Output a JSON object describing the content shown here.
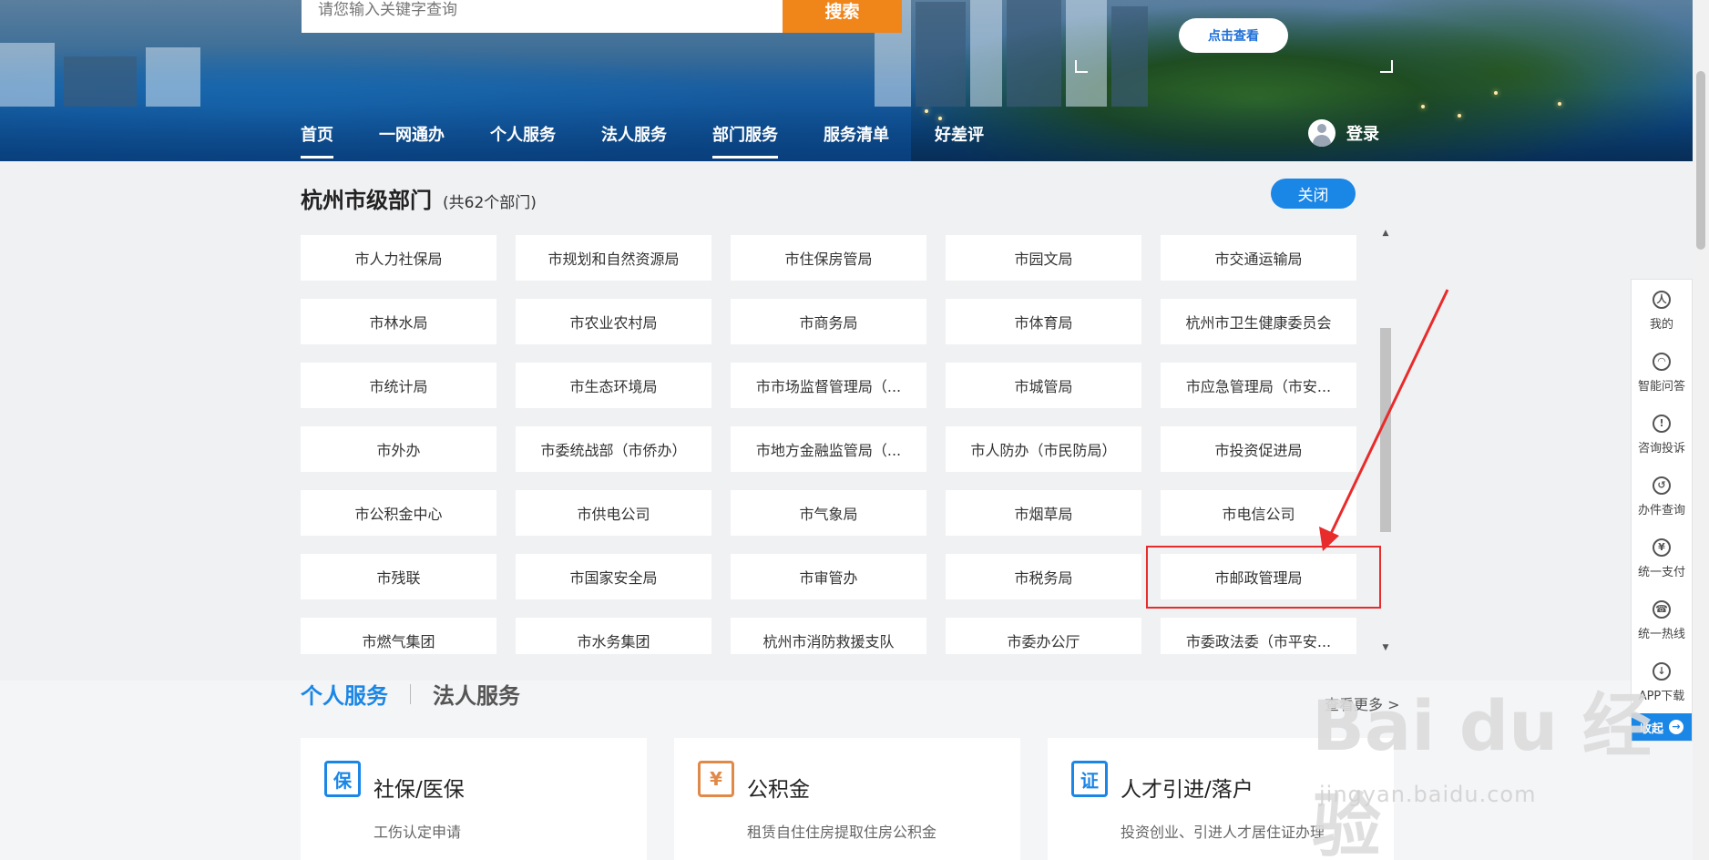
{
  "search": {
    "placeholder": "请您输入关键字查询",
    "button": "搜索"
  },
  "banner": {
    "click_view": "点击查看"
  },
  "nav": {
    "items": [
      "首页",
      "一网通办",
      "个人服务",
      "法人服务",
      "部门服务",
      "服务清单",
      "好差评"
    ],
    "login": "登录"
  },
  "departments": {
    "title": "杭州市级部门",
    "count": "(共62个部门)",
    "close": "关闭",
    "rows": [
      [
        "市人力社保局",
        "市规划和自然资源局",
        "市住保房管局",
        "市园文局",
        "市交通运输局"
      ],
      [
        "市林水局",
        "市农业农村局",
        "市商务局",
        "市体育局",
        "杭州市卫生健康委员会"
      ],
      [
        "市统计局",
        "市生态环境局",
        "市市场监督管理局（...",
        "市城管局",
        "市应急管理局（市安..."
      ],
      [
        "市外办",
        "市委统战部（市侨办）",
        "市地方金融监管局（...",
        "市人防办（市民防局）",
        "市投资促进局"
      ],
      [
        "市公积金中心",
        "市供电公司",
        "市气象局",
        "市烟草局",
        "市电信公司"
      ],
      [
        "市残联",
        "市国家安全局",
        "市审管办",
        "市税务局",
        "市邮政管理局"
      ],
      [
        "市燃气集团",
        "市水务集团",
        "杭州市消防救援支队",
        "市委办公厅",
        "市委政法委（市平安..."
      ]
    ],
    "scroll_up": "▲",
    "scroll_down": "▼"
  },
  "services": {
    "tabs": [
      "个人服务",
      "法人服务"
    ],
    "more": "查看更多 >",
    "cards": [
      {
        "icon": "保",
        "title": "社保/医保",
        "sub": "工伤认定申请",
        "sub2": ""
      },
      {
        "icon": "¥",
        "title": "公积金",
        "sub": "租赁自住住房提取住房公积金",
        "sub2": ""
      },
      {
        "icon": "证",
        "title": "人才引进/落户",
        "sub": "投资创业、引进人才居住证办理",
        "sub2": ""
      }
    ]
  },
  "sidebar": {
    "items": [
      {
        "icon": "person-icon",
        "glyph": "人",
        "label": "我的"
      },
      {
        "icon": "headset-icon",
        "glyph": "◠",
        "label": "智能问答"
      },
      {
        "icon": "alert-shield-icon",
        "glyph": "!",
        "label": "咨询投诉"
      },
      {
        "icon": "history-icon",
        "glyph": "↺",
        "label": "办件查询"
      },
      {
        "icon": "yuan-icon",
        "glyph": "¥",
        "label": "统一支付"
      },
      {
        "icon": "phone-icon",
        "glyph": "☎",
        "label": "统一热线"
      },
      {
        "icon": "download-icon",
        "glyph": "↓",
        "label": "APP下载"
      }
    ],
    "collapse": "收起",
    "collapse_arrow": "→"
  },
  "watermark": {
    "main": "Bai du 经验",
    "sub": "jingyan.baidu.com"
  },
  "colors": {
    "accent": "#1a86e6",
    "search_button": "#f08519",
    "highlight": "#e82b2b"
  }
}
